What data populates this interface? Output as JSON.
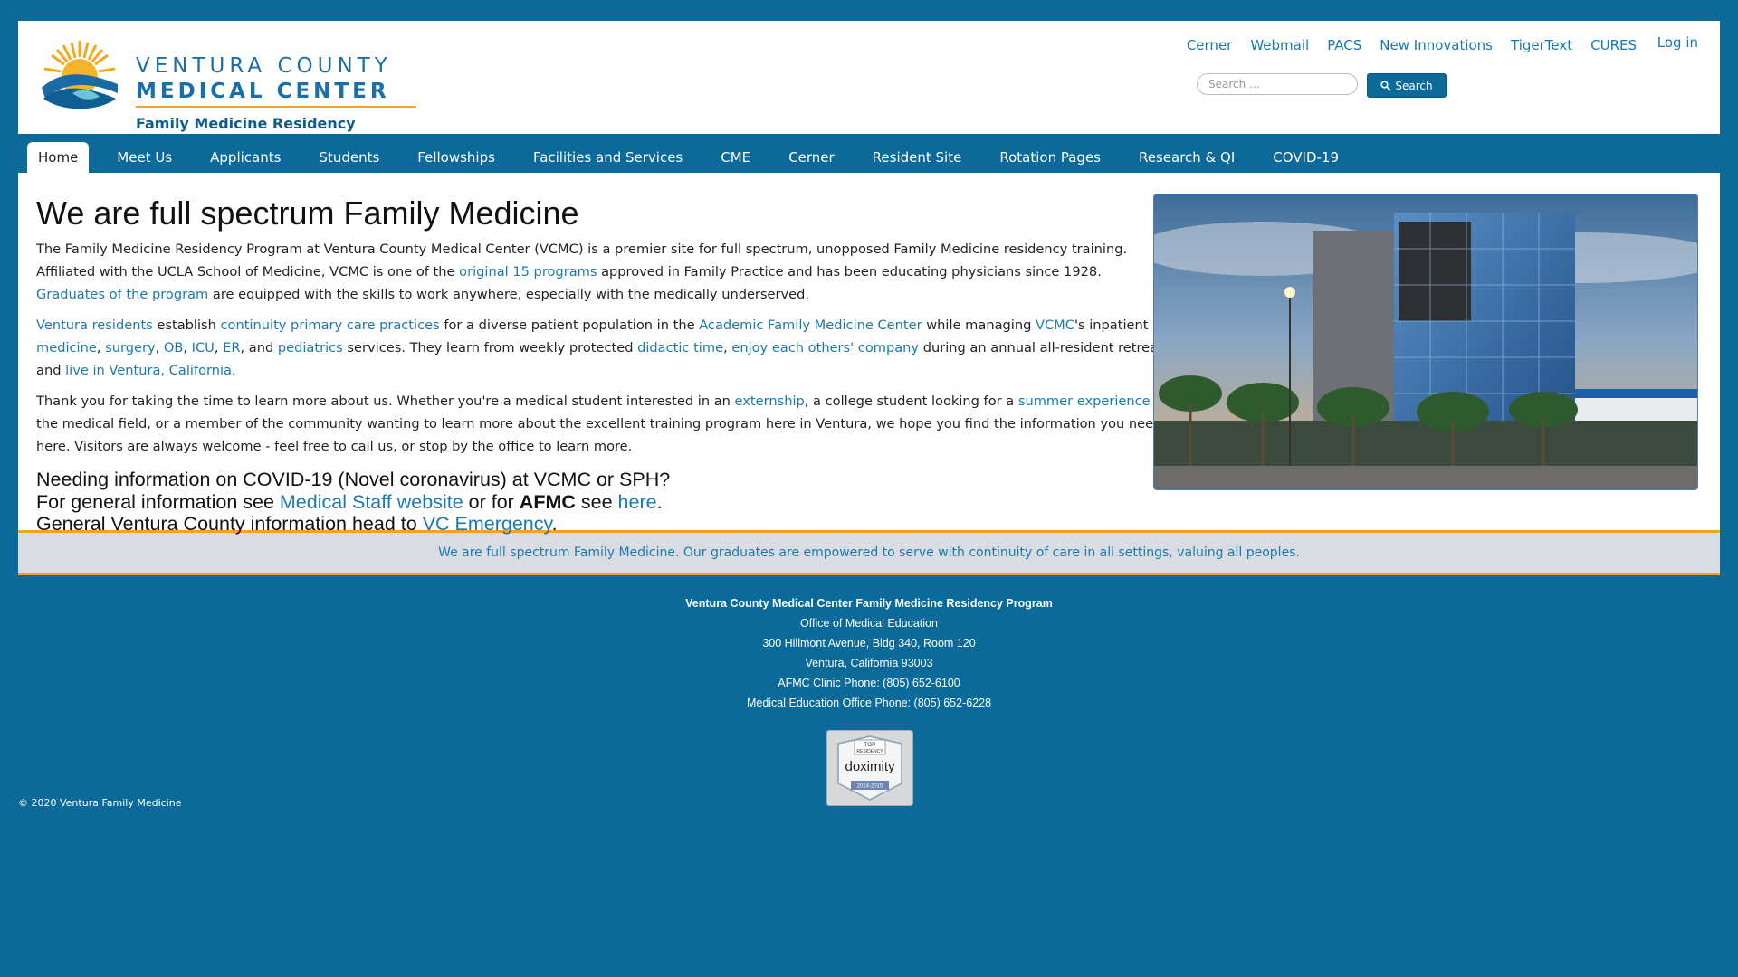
{
  "header": {
    "logo": {
      "line1": "VENTURA COUNTY",
      "line2": "MEDICAL CENTER",
      "line3": "Family Medicine Residency Program"
    },
    "top_links": [
      "Cerner",
      "Webmail",
      "PACS",
      "New Innovations",
      "TigerText",
      "CURES"
    ],
    "login_label": "Log in",
    "search": {
      "placeholder": "Search ...",
      "button_label": "Search"
    }
  },
  "nav": {
    "items": [
      "Home",
      "Meet Us",
      "Applicants",
      "Students",
      "Fellowships",
      "Facilities and Services",
      "CME",
      "Cerner",
      "Resident Site",
      "Rotation Pages",
      "Research & QI",
      "COVID-19"
    ],
    "active": "Home"
  },
  "main": {
    "title": "We are full spectrum Family Medicine",
    "p1": {
      "t1": "The Family Medicine Residency Program at Ventura County Medical Center (VCMC) is a premier site for full spectrum, unopposed Family Medicine residency training. Affiliated with the UCLA School of Medicine, VCMC is one of the ",
      "l1": "original 15 programs",
      "t2": " approved in Family Practice and has been educating physicians since 1928. ",
      "l2": "Graduates of the program",
      "t3": " are equipped with the skills to work anywhere, especially with the medically underserved."
    },
    "p2": {
      "l1": "Ventura residents",
      "t1": " establish ",
      "l2": "continuity primary care practices",
      "t2": " for a diverse patient population in the ",
      "l3": "Academic Family Medicine Center",
      "t3": " while managing ",
      "l4": "VCMC",
      "t4": "'s inpatient ",
      "l5": "medicine",
      "t5": ", ",
      "l6": "surgery",
      "t6": ", ",
      "l7": "OB",
      "t7": ", ",
      "l8": "ICU",
      "t8": ", ",
      "l9": "ER",
      "t9": ", and ",
      "l10": "pediatrics",
      "t10": " services. They learn from weekly protected ",
      "l11": "didactic time",
      "t11": ", ",
      "l12": "enjoy each others' company",
      "t12": " during an annual all-resident retreat, and ",
      "l13": "live in Ventura, California",
      "t13": "."
    },
    "p3": {
      "t1": "Thank you for taking the time to learn more about us.  Whether you're a medical student interested in an ",
      "l1": "externship",
      "t2": ", a college student looking for a ",
      "l2": "summer experience",
      "t3": " in the medical field, or a member of the community wanting to learn more about the excellent training program here in Ventura, we hope you find the information you need here.  Visitors are always welcome - feel free to call us, or stop by the office to learn more."
    },
    "covid": {
      "line1": "Needing information on COVID-19 (Novel coronavirus) at VCMC or SPH?",
      "l2a": "For general information see ",
      "l2_link": "Medical Staff website",
      "l2b": " or for ",
      "l2_bold": "AFMC",
      "l2c": " see ",
      "l2_link2": "here",
      "l2d": ".",
      "l3a": "General Ventura County information head to ",
      "l3_link": "VC Emergency",
      "l3b": "."
    }
  },
  "tagline": "We are full spectrum Family Medicine. Our graduates are empowered to serve with continuity of care in all settings, valuing all peoples.",
  "footer": {
    "name": "Ventura County Medical Center Family Medicine Residency Program",
    "line2": "Office of Medical Education",
    "line3": "300 Hillmont Avenue, Bldg 340, Room 120",
    "line4": "Ventura, California 93003",
    "line5": "AFMC Clinic Phone: (805) 652-6100",
    "line6": "Medical Education Office Phone: (805) 652-6228",
    "badge": {
      "top": "TOP",
      "sub": "RESIDENCY",
      "brand": "doximity",
      "years": "2014-2015"
    },
    "copyright": "© 2020 Ventura Family Medicine"
  },
  "colors": {
    "brand_blue": "#0b6a9a",
    "link": "#1a79b0",
    "accent_gold": "#f0a51e"
  }
}
